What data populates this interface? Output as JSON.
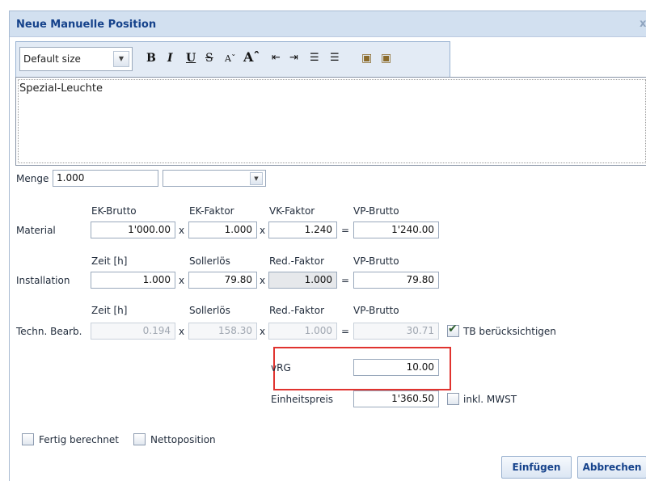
{
  "dialog": {
    "title": "Neue Manuelle Position",
    "close": "x"
  },
  "toolbar": {
    "font_size": "Default size",
    "icons": [
      "bold-icon",
      "italic-icon",
      "underline-icon",
      "strikethrough-icon",
      "decrease-font-icon",
      "increase-font-icon",
      "indent-icon",
      "outdent-icon",
      "ordered-list-icon",
      "unordered-list-icon",
      "paste-icon",
      "paste-text-icon"
    ]
  },
  "editor": {
    "text": "Spezial-Leuchte"
  },
  "menge": {
    "label": "Menge",
    "value": "1.000",
    "unit": ""
  },
  "ops": {
    "times": "x",
    "equals": "="
  },
  "material": {
    "label": "Material",
    "headers": [
      "EK-Brutto",
      "EK-Faktor",
      "VK-Faktor",
      "VP-Brutto"
    ],
    "values": [
      "1'000.00",
      "1.000",
      "1.240",
      "1'240.00"
    ]
  },
  "installation": {
    "label": "Installation",
    "headers": [
      "Zeit [h]",
      "Sollerlös",
      "Red.-Faktor",
      "VP-Brutto"
    ],
    "values": [
      "1.000",
      "79.80",
      "1.000",
      "79.80"
    ]
  },
  "techn": {
    "label": "Techn. Bearb.",
    "headers": [
      "Zeit [h]",
      "Sollerlös",
      "Red.-Faktor",
      "VP-Brutto"
    ],
    "values": [
      "0.194",
      "158.30",
      "1.000",
      "30.71"
    ],
    "tb_label": "TB berücksichtigen",
    "tb_checked": true
  },
  "vrg": {
    "label": "vRG",
    "value": "10.00"
  },
  "einheitspreis": {
    "label": "Einheitspreis",
    "value": "1'360.50",
    "mwst_label": "inkl. MWST"
  },
  "options": {
    "fertig": "Fertig berechnet",
    "netto": "Nettoposition"
  },
  "buttons": {
    "insert": "Einfügen",
    "cancel": "Abbrechen"
  },
  "icon_glyphs": {
    "check": "✔"
  }
}
